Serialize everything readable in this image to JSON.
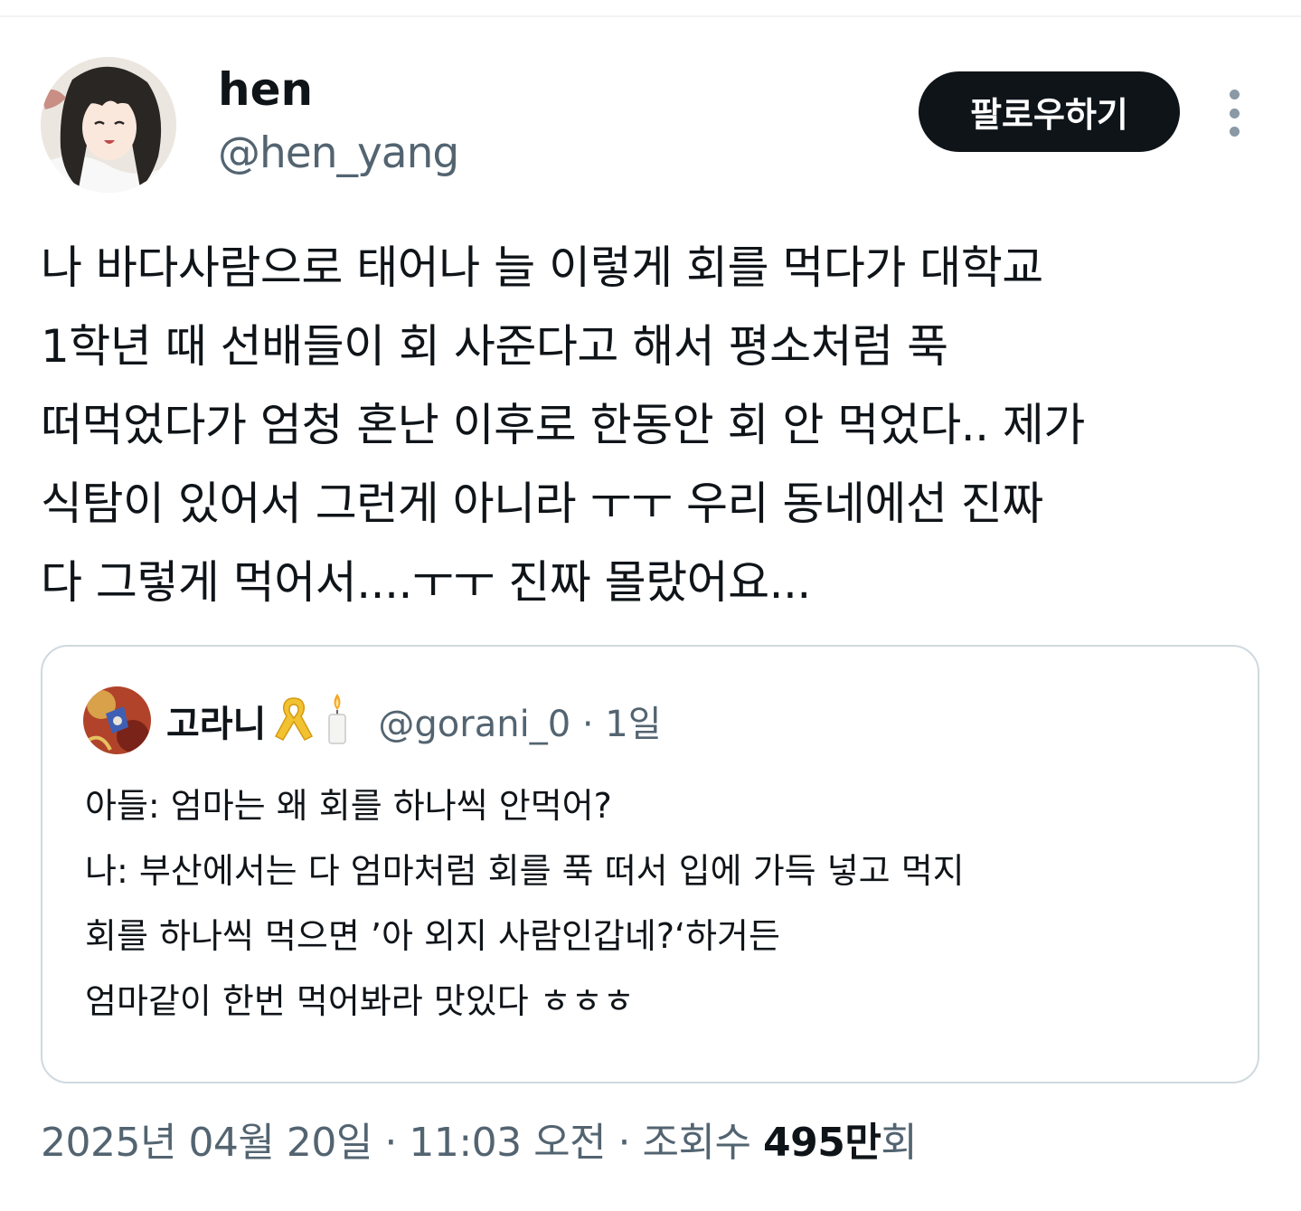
{
  "author": {
    "display_name": "hen",
    "handle": "@hen_yang",
    "avatar_icon": "anime-girl-avatar"
  },
  "actions": {
    "follow_label": "팔로우하기",
    "more_icon": "more-vertical-icon"
  },
  "tweet": {
    "lines": [
      "나 바다사람으로 태어나 늘 이렇게 회를 먹다가 대학교",
      "1학년 때 선배들이 회 사준다고 해서 평소처럼 푹",
      "떠먹었다가 엄청 혼난 이후로 한동안 회 안 먹었다.. 제가",
      "식탐이 있어서 그런게 아니라 ㅜㅜ 우리 동네에선 진짜",
      "다 그렇게 먹어서....ㅜㅜ 진짜 몰랐어요..."
    ]
  },
  "quote": {
    "author_name": "고라니",
    "name_emojis": [
      "yellow-ribbon",
      "candle"
    ],
    "handle_time": "@gorani_0 · 1일",
    "lines": [
      "아들: 엄마는 왜 회를 하나씩 안먹어?",
      "나: 부산에서는 다 엄마처럼 회를 푹 떠서 입에 가득 넣고 먹지",
      "회를 하나씩 먹으면 ’아 외지 사람인갑네?‘하거든",
      "엄마같이 한번 먹어봐라 맛있다 ㅎㅎㅎ"
    ]
  },
  "meta": {
    "timestamp": "2025년 04월 20일 · 11:03 오전 · 조회수 ",
    "views_count": "495만",
    "views_suffix": "회"
  },
  "colors": {
    "text_primary": "#0f1419",
    "text_secondary": "#536471",
    "border": "#cfd9de",
    "follow_bg": "#0f1419"
  }
}
